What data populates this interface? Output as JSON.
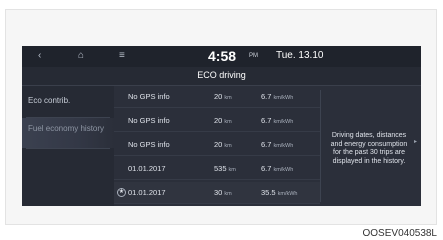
{
  "topbar": {
    "back_icon": "‹",
    "home_icon": "⌂",
    "menu_icon": "≡",
    "clock": "4:58",
    "ampm": "PM",
    "date": "Tue. 13.10"
  },
  "title": "ECO driving",
  "menu": {
    "items": [
      {
        "label": "Eco contrib."
      },
      {
        "label": "Fuel economy history"
      }
    ]
  },
  "table": {
    "unit_distance": "km",
    "unit_efficiency": "km/kWh",
    "rows": [
      {
        "label": "No GPS info",
        "distance": "20",
        "efficiency": "6.7"
      },
      {
        "label": "No GPS info",
        "distance": "20",
        "efficiency": "6.7"
      },
      {
        "label": "No GPS info",
        "distance": "20",
        "efficiency": "6.7"
      },
      {
        "label": "01.01.2017",
        "distance": "535",
        "efficiency": "6.7"
      },
      {
        "label": "01.01.2017",
        "distance": "30",
        "efficiency": "35.5",
        "star": "★"
      }
    ]
  },
  "info_text": "Driving dates, distances and energy consumption for the past 30 trips are displayed in the history.",
  "next_icon": "▸",
  "caption": "OOSEV040538L",
  "colors": {
    "screen_bg": "#2b2f3a",
    "topbar_bg": "#1f232c",
    "text": "#dfe3ea"
  }
}
